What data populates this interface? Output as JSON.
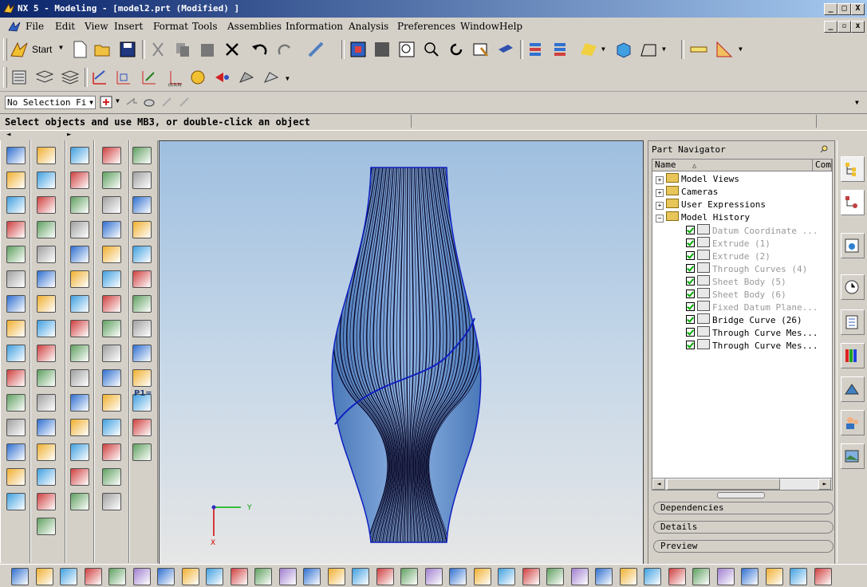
{
  "window": {
    "title": "NX 5 - Modeling - [model2.prt (Modified) ]",
    "minimize": "_",
    "maximize": "□",
    "close": "X"
  },
  "menu": [
    "File",
    "Edit",
    "View",
    "Insert",
    "Format",
    "Tools",
    "Assemblies",
    "Information",
    "Analysis",
    "Preferences",
    "Window",
    "Help"
  ],
  "toolbar": {
    "start_label": "Start"
  },
  "selection_bar": {
    "filter": "No Selection Fi"
  },
  "cue_line": "Select objects and use MB3, or double-click an object",
  "palette": {
    "p1_label": "P1="
  },
  "graphics": {
    "triad_y": "Y",
    "triad_x": "X"
  },
  "navigator": {
    "title": "Part Navigator",
    "col_name": "Name",
    "col_comment": "Com",
    "items": [
      {
        "label": "Model Views",
        "level": 0,
        "state": "expand"
      },
      {
        "label": "Cameras",
        "level": 0,
        "state": "expand"
      },
      {
        "label": "User Expressions",
        "level": 0,
        "state": "expand"
      },
      {
        "label": "Model History",
        "level": 0,
        "state": "collapse"
      },
      {
        "label": "Datum Coordinate ...",
        "level": 1,
        "gray": true
      },
      {
        "label": "Extrude (1)",
        "level": 1,
        "gray": true
      },
      {
        "label": "Extrude (2)",
        "level": 1,
        "gray": true
      },
      {
        "label": "Through Curves (4)",
        "level": 1,
        "gray": true
      },
      {
        "label": "Sheet Body (5)",
        "level": 1,
        "gray": true
      },
      {
        "label": "Sheet Body (6)",
        "level": 1,
        "gray": true
      },
      {
        "label": "Fixed Datum Plane...",
        "level": 1,
        "gray": true
      },
      {
        "label": "Bridge Curve (26)",
        "level": 1,
        "gray": false
      },
      {
        "label": "Through Curve Mes...",
        "level": 1,
        "gray": false
      },
      {
        "label": "Through Curve Mes...",
        "level": 1,
        "gray": false
      }
    ],
    "sections": [
      "Dependencies",
      "Details",
      "Preview"
    ]
  },
  "colors": {
    "title_start": "#0a246a",
    "model_fill": "#7fa6d8",
    "model_lines": "#0a0a2a",
    "bridge_curve": "#1020c0"
  }
}
